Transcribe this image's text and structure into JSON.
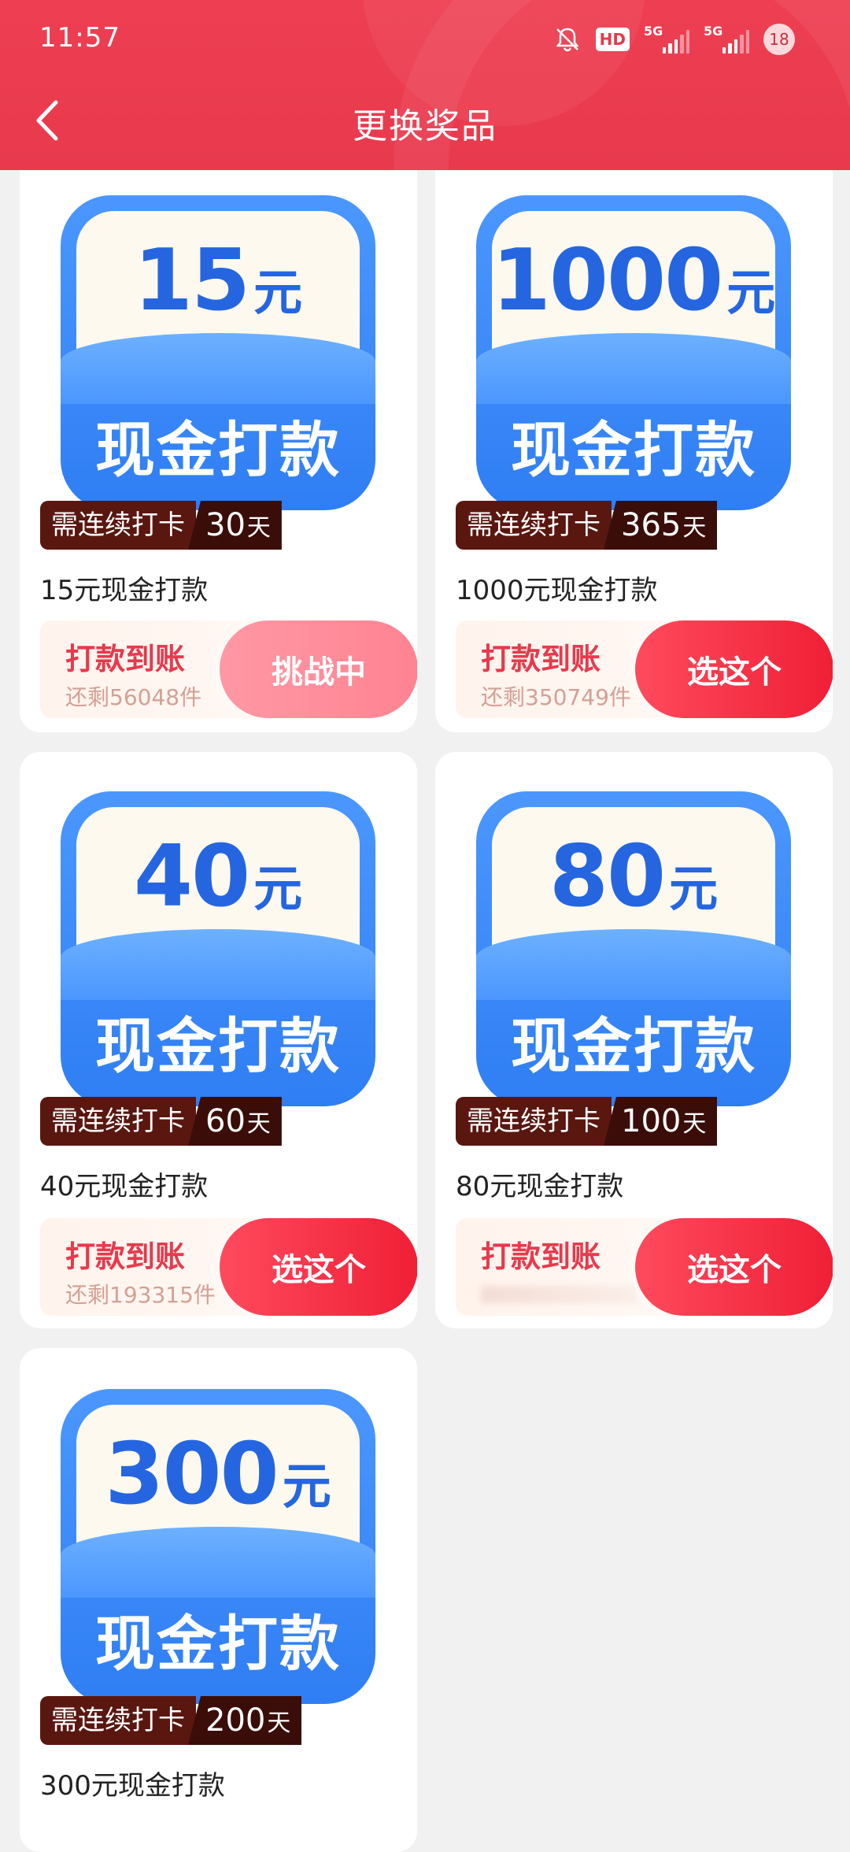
{
  "status_bar": {
    "time": "11:57",
    "hd_badge": "HD",
    "network1": "5G",
    "network2": "5G",
    "battery": "18"
  },
  "header": {
    "title": "更换奖品"
  },
  "colors": {
    "header_red": "#e8394d",
    "prize_blue": "#2f7ef3",
    "button_red": "#ef1f36",
    "button_active_pink": "#ff8392",
    "badge_brown": "#5a1710"
  },
  "prizes": [
    {
      "amount": "15",
      "unit": "元",
      "cash_label": "现金打款",
      "streak_label": "需连续打卡",
      "streak_days": "30",
      "days_unit": "天",
      "name": "15元现金打款",
      "pay_label": "打款到账",
      "stock": "还剩56048件",
      "button": "挑战中"
    },
    {
      "amount": "1000",
      "unit": "元",
      "cash_label": "现金打款",
      "streak_label": "需连续打卡",
      "streak_days": "365",
      "days_unit": "天",
      "name": "1000元现金打款",
      "pay_label": "打款到账",
      "stock": "还剩350749件",
      "button": "选这个"
    },
    {
      "amount": "40",
      "unit": "元",
      "cash_label": "现金打款",
      "streak_label": "需连续打卡",
      "streak_days": "60",
      "days_unit": "天",
      "name": "40元现金打款",
      "pay_label": "打款到账",
      "stock": "还剩193315件",
      "button": "选这个"
    },
    {
      "amount": "80",
      "unit": "元",
      "cash_label": "现金打款",
      "streak_label": "需连续打卡",
      "streak_days": "100",
      "days_unit": "天",
      "name": "80元现金打款",
      "pay_label": "打款到账",
      "button": "选这个"
    },
    {
      "amount": "300",
      "unit": "元",
      "cash_label": "现金打款",
      "streak_label": "需连续打卡",
      "streak_days": "200",
      "days_unit": "天",
      "name": "300元现金打款"
    }
  ]
}
